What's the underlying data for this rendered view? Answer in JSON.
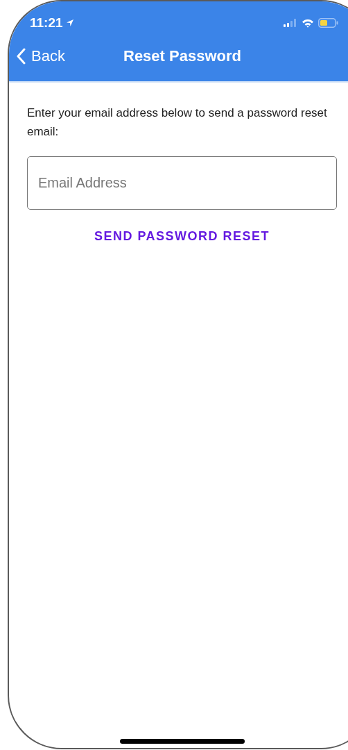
{
  "status_bar": {
    "time": "11:21"
  },
  "nav": {
    "back": "Back",
    "title": "Reset Password"
  },
  "instructions": "Enter your email address below to send a password reset email:",
  "email_field": {
    "placeholder": "Email Address"
  },
  "submit_button": "SEND PASSWORD RESET"
}
